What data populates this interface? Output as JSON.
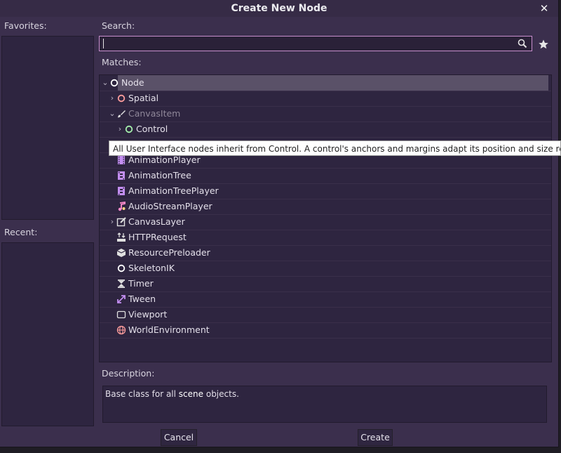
{
  "dialog": {
    "title": "Create New Node",
    "close_glyph": "✕"
  },
  "favorites": {
    "label": "Favorites:"
  },
  "recent": {
    "label": "Recent:"
  },
  "search": {
    "label": "Search:",
    "value": "",
    "placeholder": ""
  },
  "matches": {
    "label": "Matches:",
    "items": [
      {
        "label": "Node",
        "icon": "node-circle-icon",
        "expander": "⌄",
        "selected": true
      },
      {
        "label": "Spatial",
        "icon": "spatial-circle-icon",
        "expander": "›"
      },
      {
        "label": "CanvasItem",
        "icon": "brush-icon",
        "expander": "⌄",
        "dim": true
      },
      {
        "label": "Control",
        "icon": "control-circle-icon",
        "expander": "›"
      },
      {
        "label": "AnimationPlayer",
        "icon": "film-icon"
      },
      {
        "label": "AnimationTree",
        "icon": "animation-tree-icon"
      },
      {
        "label": "AnimationTreePlayer",
        "icon": "animation-tree-player-icon"
      },
      {
        "label": "AudioStreamPlayer",
        "icon": "music-note-icon"
      },
      {
        "label": "CanvasLayer",
        "icon": "canvas-layer-icon",
        "expander": "›"
      },
      {
        "label": "HTTPRequest",
        "icon": "http-request-icon"
      },
      {
        "label": "ResourcePreloader",
        "icon": "cube-icon"
      },
      {
        "label": "SkeletonIK",
        "icon": "skeleton-circle-icon"
      },
      {
        "label": "Timer",
        "icon": "hourglass-icon"
      },
      {
        "label": "Tween",
        "icon": "tween-arrow-icon"
      },
      {
        "label": "Viewport",
        "icon": "viewport-square-icon"
      },
      {
        "label": "WorldEnvironment",
        "icon": "globe-icon"
      }
    ]
  },
  "tooltip": {
    "text": "All User Interface nodes inherit from Control. A control's anchors and margins adapt its position and size relative"
  },
  "description": {
    "label": "Description:",
    "text_before": "Base class for all ",
    "text_highlight": "scene",
    "text_after": " objects."
  },
  "buttons": {
    "cancel": "Cancel",
    "create": "Create"
  },
  "colors": {
    "background": "#3b2f4d",
    "panel": "#2e2540",
    "search_border": "#c98fce",
    "selected_row": "#5a5168"
  }
}
